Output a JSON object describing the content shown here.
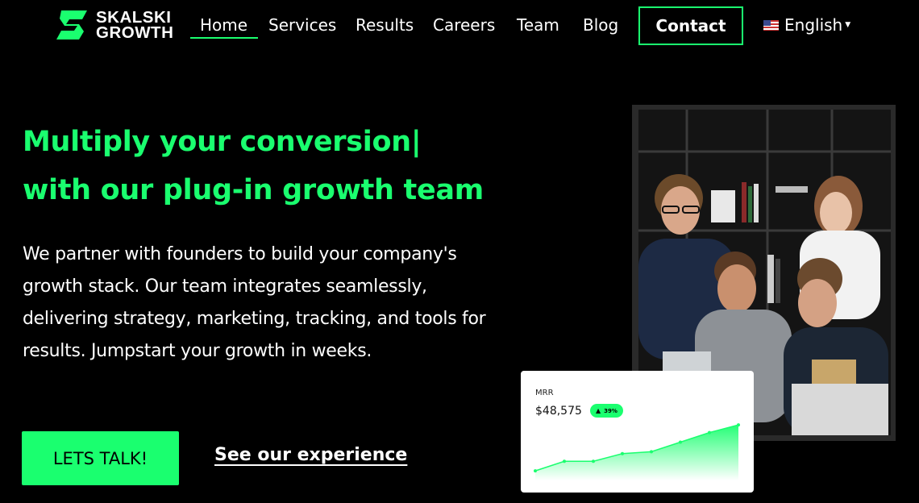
{
  "brand": {
    "line1": "SKALSKI",
    "line2": "GROWTH",
    "accent": "#1aff6f"
  },
  "nav": {
    "items": [
      "Home",
      "Services",
      "Results",
      "Careers",
      "Team",
      "Blog"
    ],
    "active": "Home",
    "contact": "Contact",
    "language": "English"
  },
  "hero": {
    "headline_line1": "Multiply your conversion|",
    "headline_line2": "with our plug-in growth team",
    "paragraph": "We partner with founders to build your company's growth stack. Our team integrates seamlessly, delivering strategy, marketing, tracking, and tools for results. Jumpstart your growth in weeks.",
    "cta_primary": "LETS TALK!",
    "cta_secondary": "See our experience"
  },
  "mrr_card": {
    "label": "MRR",
    "value": "$48,575",
    "badge": "39%"
  },
  "chart_data": {
    "type": "area",
    "title": "MRR",
    "x": [
      1,
      2,
      3,
      4,
      5,
      6,
      7,
      8
    ],
    "series": [
      {
        "values": [
          10,
          20,
          20,
          28,
          30,
          40,
          50,
          58
        ]
      }
    ],
    "ylim": [
      0,
      64
    ],
    "grid": false
  },
  "icons": {
    "logo": "skalski-growth-logo-icon",
    "flag": "us-flag-icon",
    "dropdown": "chevron-down-icon",
    "trend": "trend-up-icon"
  }
}
